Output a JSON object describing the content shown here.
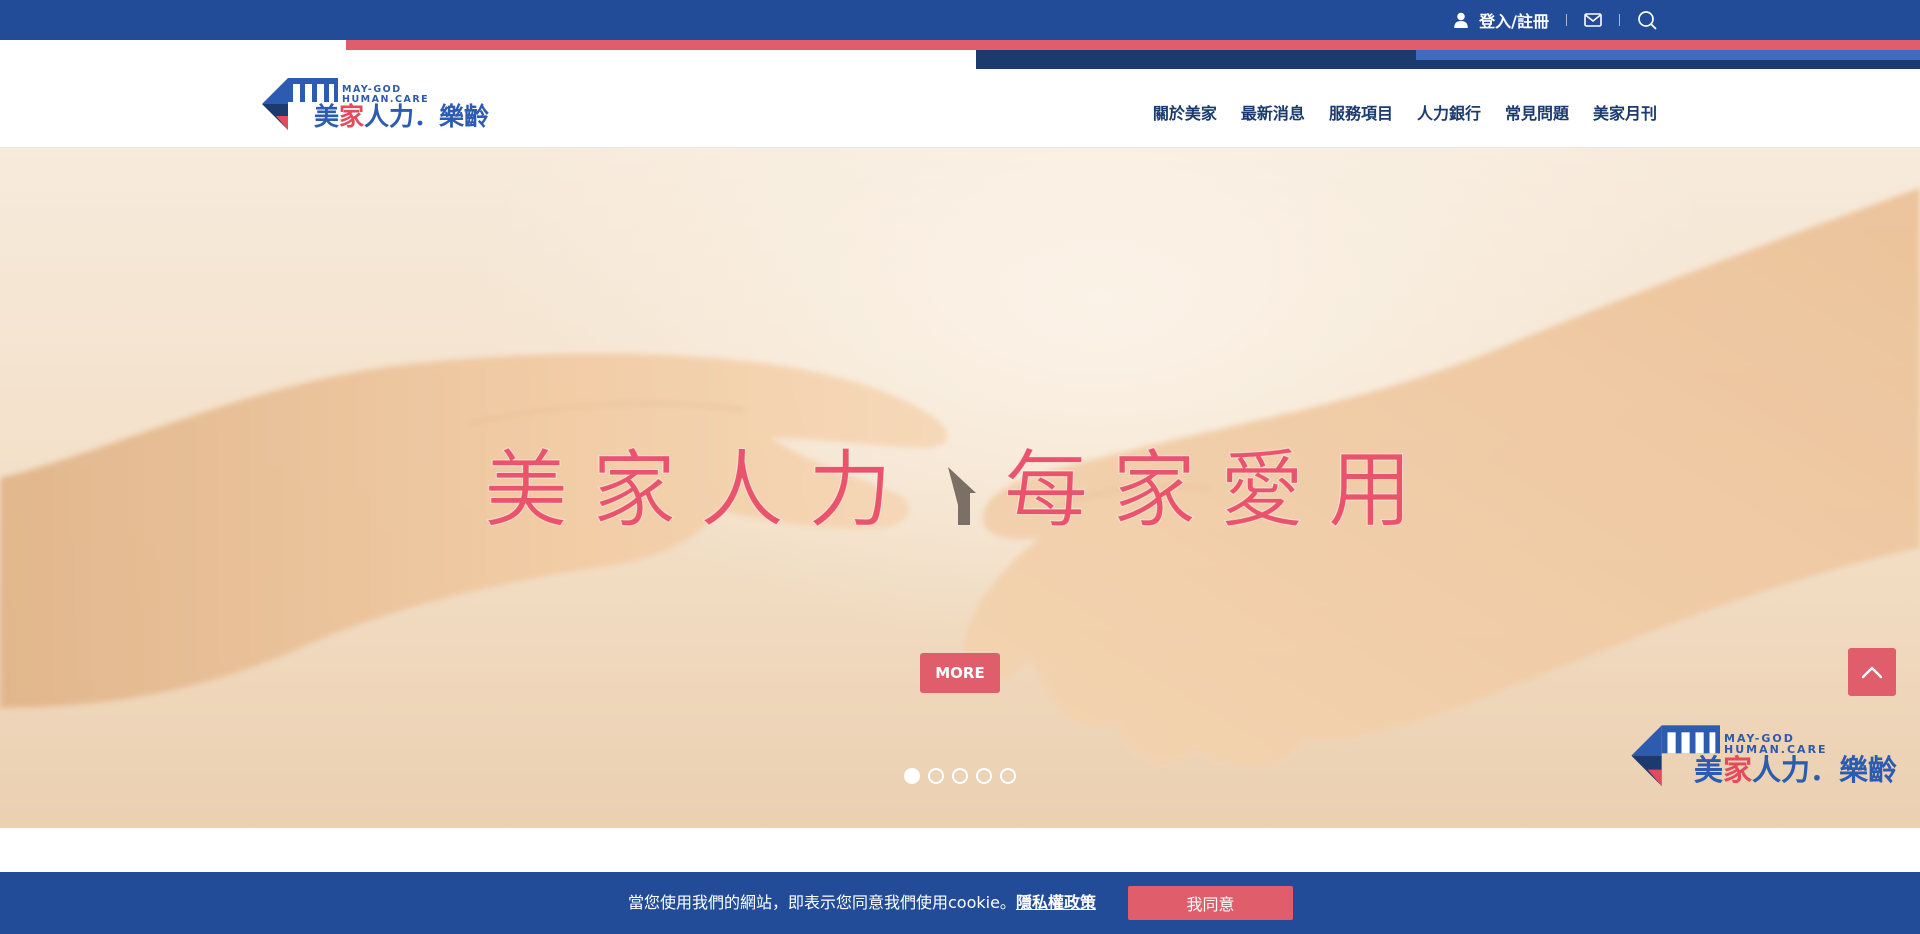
{
  "topbar": {
    "login_label": "登入/註冊",
    "icons": [
      "user-icon",
      "mail-icon",
      "search-icon"
    ]
  },
  "logo": {
    "en_line1": "MAY-GOD",
    "en_line2": "HUMAN.CARE",
    "cn_part1": "美",
    "cn_part2": "家",
    "cn_part3": "人力．樂齡"
  },
  "nav": {
    "items": [
      "關於美家",
      "最新消息",
      "服務項目",
      "人力銀行",
      "常見問題",
      "美家月刊"
    ]
  },
  "hero": {
    "title_left": "美家人力",
    "title_right": "每家愛用",
    "more_label": "MORE",
    "slide_count": 5,
    "active_slide": 1
  },
  "cookie": {
    "message": "當您使用我們的網站，即表示您同意我們使用cookie。",
    "policy_link": "隱私權政策",
    "agree_label": "我同意"
  },
  "colors": {
    "primary_blue": "#224c97",
    "accent_red": "#e05d6b",
    "navy": "#1b3a6e"
  }
}
